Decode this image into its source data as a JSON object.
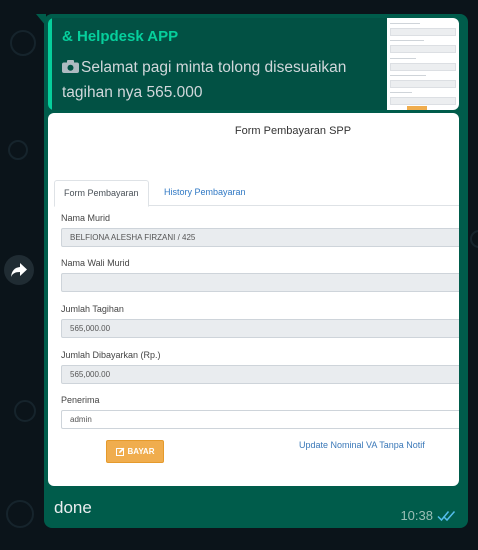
{
  "quoted": {
    "sender": "& Helpdesk APP",
    "message": "Selamat pagi minta tolong disesuaikan tagihan nya 565.000",
    "icon": "camera-icon"
  },
  "form": {
    "title": "Form Pembayaran SPP",
    "tabs": [
      "Form Pembayaran",
      "History Pembayaran"
    ],
    "fields": [
      {
        "label": "Nama Murid",
        "value": "BELFIONA ALESHA FIRZANI / 425"
      },
      {
        "label": "Nama Wali Murid",
        "value": ""
      },
      {
        "label": "Jumlah Tagihan",
        "value": "565,000.00"
      },
      {
        "label": "Jumlah Dibayarkan (Rp.)",
        "value": "565,000.00"
      },
      {
        "label": "Penerima",
        "value": "admin"
      }
    ],
    "pay_button": "BAYAR",
    "update_link": "Update Nominal VA Tanpa Notif"
  },
  "message": {
    "caption": "done",
    "time": "10:38",
    "status": "read"
  },
  "colors": {
    "background": "#0b141a",
    "bubble": "#005c4b",
    "quote_accent": "#06cf9c",
    "read_ticks": "#53bdeb",
    "pay_button": "#f0ad4e"
  }
}
